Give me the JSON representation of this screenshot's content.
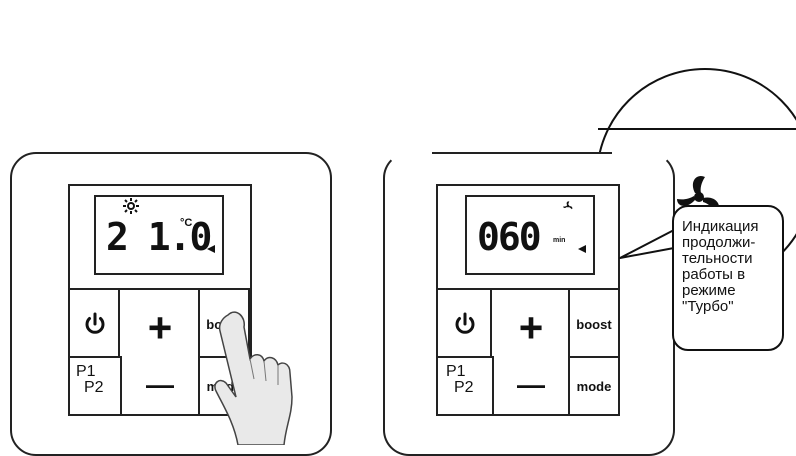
{
  "left_panel": {
    "display_value": "2 1.0",
    "unit": "°C",
    "buttons": {
      "power_icon": "power-icon",
      "plus": "+",
      "minus": "—",
      "boost": "boost",
      "mode": "mode",
      "p1": "P1",
      "p2": "P2"
    }
  },
  "right_panel": {
    "display_value": "060",
    "unit_suffix": "min",
    "buttons": {
      "power_icon": "power-icon",
      "plus": "+",
      "minus": "—",
      "boost": "boost",
      "mode": "mode",
      "p1": "P1",
      "p2": "P2"
    }
  },
  "callout": {
    "text": "Индикация\nпродолжи-\nтельности\nработы в\nрежиме\n\"Турбо\""
  },
  "magnifier": {
    "icon": "fan-icon"
  }
}
